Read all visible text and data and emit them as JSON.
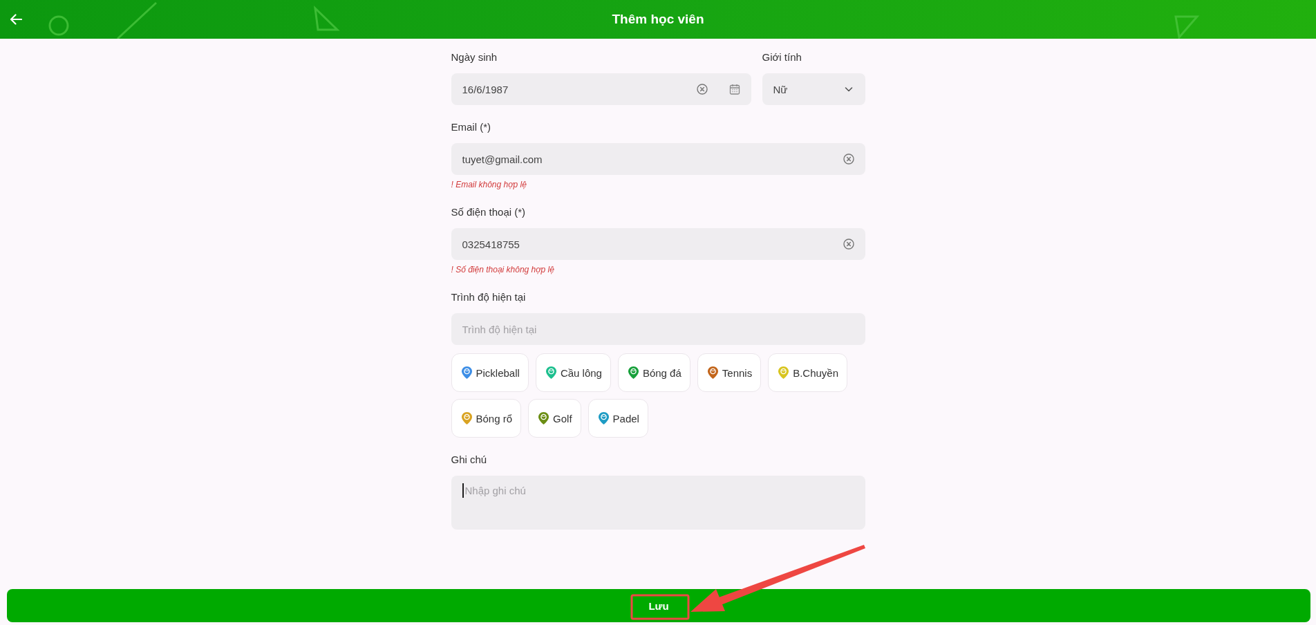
{
  "header": {
    "title": "Thêm học viên"
  },
  "form": {
    "birth_date": {
      "label": "Ngày sinh",
      "value": "16/6/1987"
    },
    "gender": {
      "label": "Giới tính",
      "value": "Nữ"
    },
    "email": {
      "label": "Email (*)",
      "value": "tuyet@gmail.com",
      "error": "! Email không hợp lệ"
    },
    "phone": {
      "label": "Số điện thoại (*)",
      "value": "0325418755",
      "error": "! Số điện thoại không hợp lệ"
    },
    "current_skill": {
      "label": "Trình độ hiện tại",
      "placeholder": "Trình độ hiện tại"
    },
    "sports": [
      {
        "label": "Pickleball",
        "color": "#3d8ee6",
        "selected": false
      },
      {
        "label": "Cầu lông",
        "color": "#1dbf8e",
        "selected": false
      },
      {
        "label": "Bóng đá",
        "color": "#17a03b",
        "selected": false
      },
      {
        "label": "Tennis",
        "color": "#c2651b",
        "selected": false
      },
      {
        "label": "B.Chuyền",
        "color": "#d8c520",
        "selected": false
      },
      {
        "label": "Bóng rổ",
        "color": "#d9a322",
        "selected": false
      },
      {
        "label": "Golf",
        "color": "#6b8e14",
        "selected": false
      },
      {
        "label": "Padel",
        "color": "#1e9cc4",
        "selected": false
      }
    ],
    "notes": {
      "label": "Ghi chú",
      "placeholder": "Nhập ghi chú",
      "focused": true
    }
  },
  "save_button": {
    "label": "Lưu"
  },
  "annotation": {
    "highlight": true,
    "arrow": true
  }
}
